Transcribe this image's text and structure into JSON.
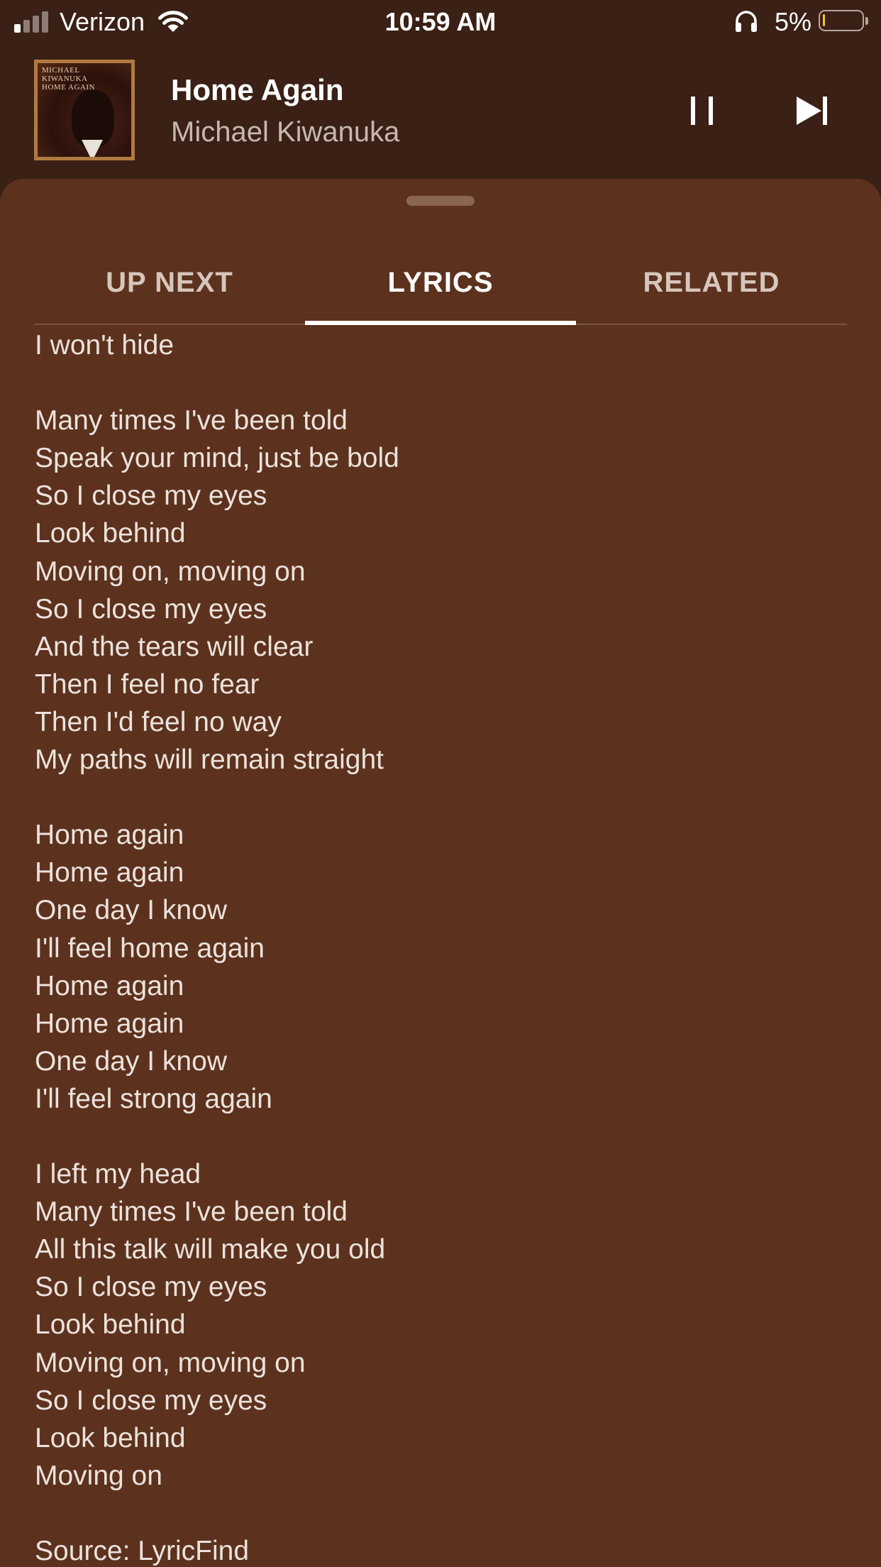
{
  "status_bar": {
    "carrier": "Verizon",
    "time": "10:59 AM",
    "battery_percent": "5%",
    "signal_bars_active": 1,
    "signal_bars_total": 4,
    "battery_level_fraction": 0.05,
    "colors": {
      "signal_active": "#ffffff",
      "signal_inactive": "#8d7d75",
      "battery_low": "#f4c430"
    }
  },
  "now_playing": {
    "title": "Home Again",
    "artist": "Michael Kiwanuka",
    "album_art_text": "MICHAEL KIWANUKA HOME AGAIN",
    "controls": {
      "pause": "pause-icon",
      "next": "skip-next-icon"
    }
  },
  "tabs": [
    {
      "label": "UP NEXT",
      "active": false
    },
    {
      "label": "LYRICS",
      "active": true
    },
    {
      "label": "RELATED",
      "active": false
    }
  ],
  "lyrics": {
    "stanzas": [
      [
        "I won't hide"
      ],
      [
        "Many times I've been told",
        "Speak your mind, just be bold",
        "So I close my eyes",
        "Look behind",
        "Moving on, moving on",
        "So I close my eyes",
        "And the tears will clear",
        "Then I feel no fear",
        "Then I'd feel no way",
        "My paths will remain straight"
      ],
      [
        "Home again",
        "Home again",
        "One day I know",
        "I'll feel home again",
        "Home again",
        "Home again",
        "One day I know",
        "I'll feel strong again"
      ],
      [
        "I left my head",
        "Many times I've been told",
        "All this talk will make you old",
        "So I close my eyes",
        "Look behind",
        "Moving on, moving on",
        "So I close my eyes",
        "Look behind",
        "Moving on"
      ]
    ],
    "source": "Source: LyricFind"
  },
  "theme": {
    "background": "#3a2015",
    "sheet": "#5c321e",
    "tab_inactive": "#d6c6bb",
    "tab_active": "#ffffff",
    "lyric_text": "#ece2dc"
  }
}
